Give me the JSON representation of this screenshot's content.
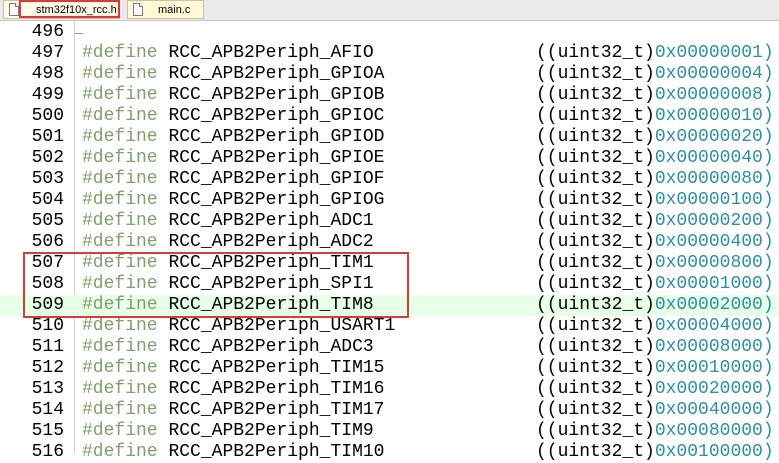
{
  "tabs": [
    {
      "label": "stm32f10x_rcc.h",
      "active": true
    },
    {
      "label": "main.c",
      "active": false
    }
  ],
  "lines": [
    {
      "num": "496",
      "kw": "",
      "name": "",
      "type": "",
      "hex": ""
    },
    {
      "num": "497",
      "kw": "#define",
      "name": "RCC_APB2Periph_AFIO",
      "type": "((uint32_t)",
      "hex": "0x00000001)"
    },
    {
      "num": "498",
      "kw": "#define",
      "name": "RCC_APB2Periph_GPIOA",
      "type": "((uint32_t)",
      "hex": "0x00000004)"
    },
    {
      "num": "499",
      "kw": "#define",
      "name": "RCC_APB2Periph_GPIOB",
      "type": "((uint32_t)",
      "hex": "0x00000008)"
    },
    {
      "num": "500",
      "kw": "#define",
      "name": "RCC_APB2Periph_GPIOC",
      "type": "((uint32_t)",
      "hex": "0x00000010)"
    },
    {
      "num": "501",
      "kw": "#define",
      "name": "RCC_APB2Periph_GPIOD",
      "type": "((uint32_t)",
      "hex": "0x00000020)"
    },
    {
      "num": "502",
      "kw": "#define",
      "name": "RCC_APB2Periph_GPIOE",
      "type": "((uint32_t)",
      "hex": "0x00000040)"
    },
    {
      "num": "503",
      "kw": "#define",
      "name": "RCC_APB2Periph_GPIOF",
      "type": "((uint32_t)",
      "hex": "0x00000080)"
    },
    {
      "num": "504",
      "kw": "#define",
      "name": "RCC_APB2Periph_GPIOG",
      "type": "((uint32_t)",
      "hex": "0x00000100)"
    },
    {
      "num": "505",
      "kw": "#define",
      "name": "RCC_APB2Periph_ADC1",
      "type": "((uint32_t)",
      "hex": "0x00000200)"
    },
    {
      "num": "506",
      "kw": "#define",
      "name": "RCC_APB2Periph_ADC2",
      "type": "((uint32_t)",
      "hex": "0x00000400)"
    },
    {
      "num": "507",
      "kw": "#define",
      "name": "RCC_APB2Periph_TIM1",
      "type": "((uint32_t)",
      "hex": "0x00000800)"
    },
    {
      "num": "508",
      "kw": "#define",
      "name": "RCC_APB2Periph_SPI1",
      "type": "((uint32_t)",
      "hex": "0x00001000)"
    },
    {
      "num": "509",
      "kw": "#define",
      "name": "RCC_APB2Periph_TIM8",
      "type": "((uint32_t)",
      "hex": "0x00002000)"
    },
    {
      "num": "510",
      "kw": "#define",
      "name": "RCC_APB2Periph_USART1",
      "type": "((uint32_t)",
      "hex": "0x00004000)"
    },
    {
      "num": "511",
      "kw": "#define",
      "name": "RCC_APB2Periph_ADC3",
      "type": "((uint32_t)",
      "hex": "0x00008000)"
    },
    {
      "num": "512",
      "kw": "#define",
      "name": "RCC_APB2Periph_TIM15",
      "type": "((uint32_t)",
      "hex": "0x00010000)"
    },
    {
      "num": "513",
      "kw": "#define",
      "name": "RCC_APB2Periph_TIM16",
      "type": "((uint32_t)",
      "hex": "0x00020000)"
    },
    {
      "num": "514",
      "kw": "#define",
      "name": "RCC_APB2Periph_TIM17",
      "type": "((uint32_t)",
      "hex": "0x00040000)"
    },
    {
      "num": "515",
      "kw": "#define",
      "name": "RCC_APB2Periph_TIM9",
      "type": "((uint32_t)",
      "hex": "0x00080000)"
    },
    {
      "num": "516",
      "kw": "#define",
      "name": "RCC_APB2Periph_TIM10",
      "type": "((uint32_t)",
      "hex": "0x00100000)"
    }
  ],
  "highlighted_line": "509",
  "colors": {
    "keyword": "#7fa06c",
    "hex": "#2d8fa3",
    "annotation": "#d93a3a",
    "current_line": "#e8ffe8"
  }
}
